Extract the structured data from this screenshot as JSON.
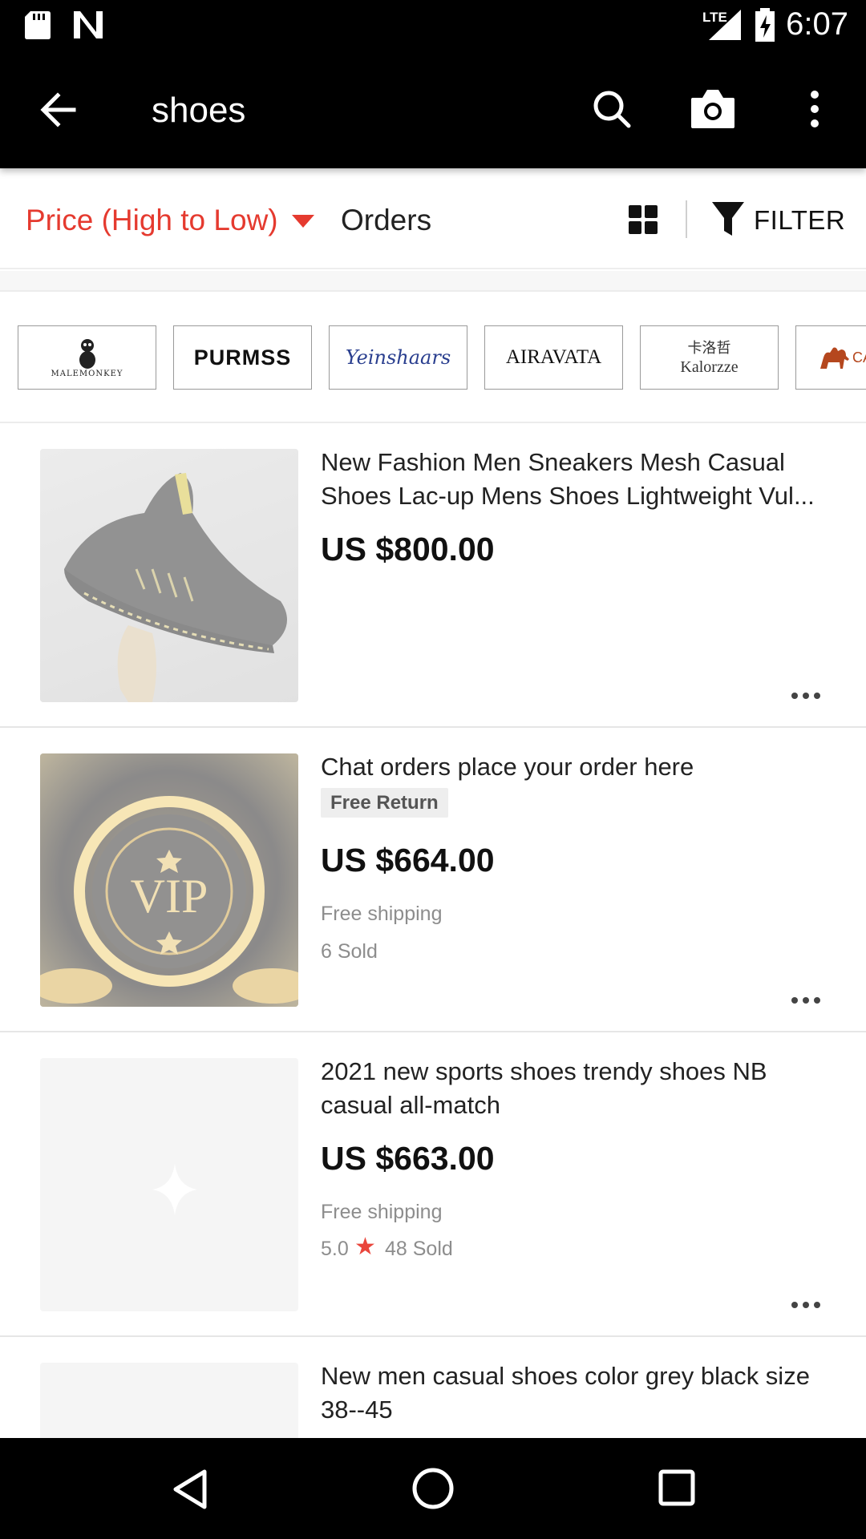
{
  "status": {
    "time": "6:07",
    "network": "LTE"
  },
  "toolbar": {
    "title": "shoes"
  },
  "sort": {
    "price_label": "Price (High to Low)",
    "orders_label": "Orders",
    "filter_label": "FILTER"
  },
  "brands": [
    {
      "name": "MALEMONKEY"
    },
    {
      "name": "PURMSS"
    },
    {
      "name": "Yeinshaars"
    },
    {
      "name": "AIRAVATA"
    },
    {
      "name": "卡洛哲",
      "sub": "Kalorzze"
    },
    {
      "name": "CA"
    }
  ],
  "products": [
    {
      "title": "New Fashion Men Sneakers Mesh Casual Shoes Lac-up Mens Shoes Lightweight Vul...",
      "price": "US $800.00"
    },
    {
      "title": "Chat orders place your order here",
      "badge": "Free Return",
      "price": "US $664.00",
      "shipping": "Free shipping",
      "sold": "6 Sold",
      "thumb_text": "VIP"
    },
    {
      "title": "2021 new sports shoes trendy shoes NB casual all-match",
      "price": "US $663.00",
      "shipping": "Free shipping",
      "rating": "5.0",
      "sold": "48 Sold"
    },
    {
      "title": "New men casual shoes color grey black size 38--45"
    }
  ],
  "colors": {
    "accent": "#e53a2f",
    "bar": "#000000"
  }
}
